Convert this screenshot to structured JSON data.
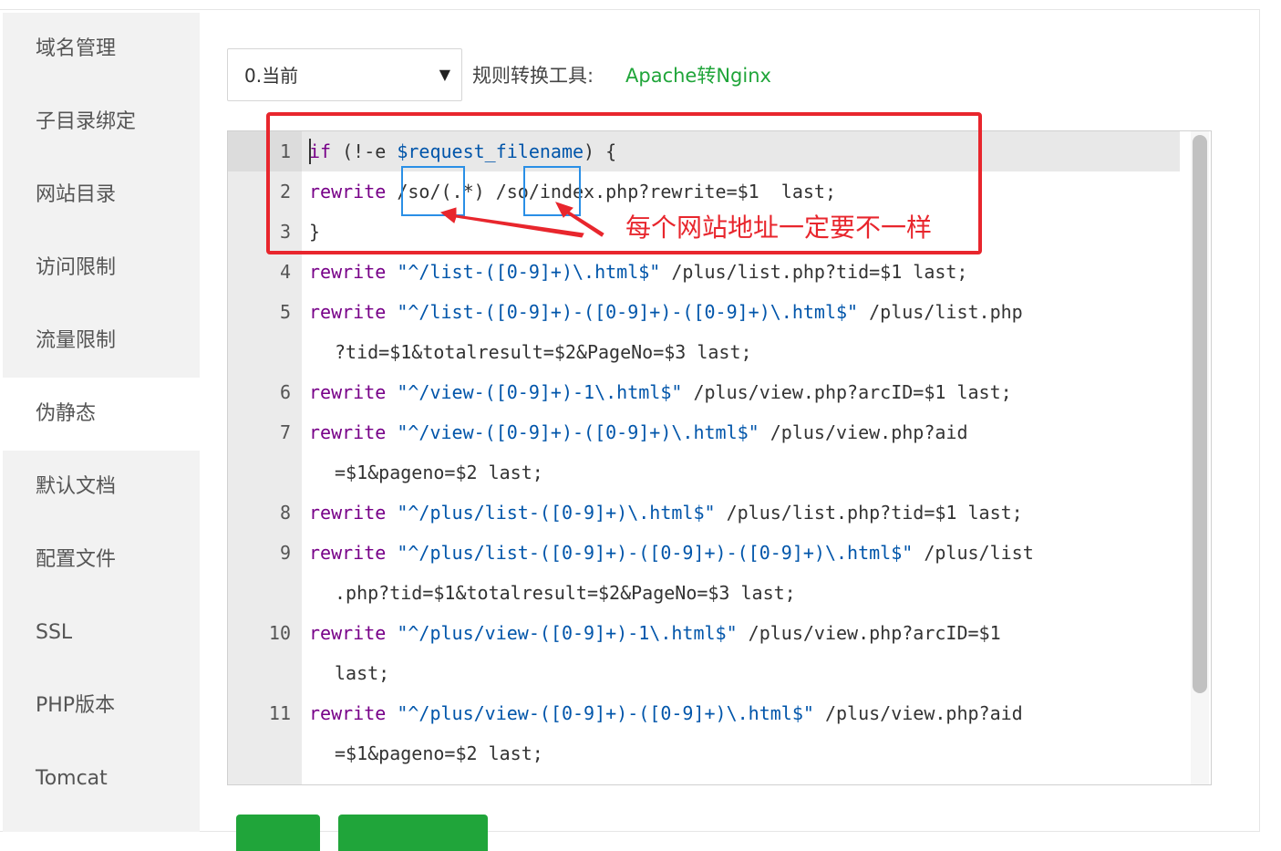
{
  "sidebar": {
    "items": [
      {
        "label": "域名管理"
      },
      {
        "label": "子目录绑定"
      },
      {
        "label": "网站目录"
      },
      {
        "label": "访问限制"
      },
      {
        "label": "流量限制"
      },
      {
        "label": "伪静态",
        "active": true
      },
      {
        "label": "默认文档"
      },
      {
        "label": "配置文件"
      },
      {
        "label": "SSL"
      },
      {
        "label": "PHP版本"
      },
      {
        "label": "Tomcat"
      }
    ]
  },
  "toolbar": {
    "select_value": "0.当前",
    "caret": "▼",
    "tool_label": "规则转换工具:",
    "tool_link": "Apache转Nginx"
  },
  "editor": {
    "lines": [
      {
        "num": "1"
      },
      {
        "num": "2"
      },
      {
        "num": "3"
      },
      {
        "num": "4"
      },
      {
        "num": "5"
      },
      {
        "num": "6"
      },
      {
        "num": "7"
      },
      {
        "num": "8"
      },
      {
        "num": "9"
      },
      {
        "num": "10"
      },
      {
        "num": "11"
      }
    ],
    "tokens": {
      "l1": [
        "if",
        " (!-e ",
        "$request_filename",
        ") {"
      ],
      "l2": [
        "rewrite",
        " /so/(.*) /so/index.php?rewrite=$1  last;"
      ],
      "l3": [
        "}"
      ],
      "l4": [
        "rewrite",
        " ",
        "\"^/list-([0-9]+)\\.html$\"",
        " /plus/list.php?tid=$1 last;"
      ],
      "l5a": [
        "rewrite",
        " ",
        "\"^/list-([0-9]+)-([0-9]+)-([0-9]+)\\.html$\"",
        " /plus/list.php"
      ],
      "l5b": "?tid=$1&totalresult=$2&PageNo=$3 last;",
      "l6": [
        "rewrite",
        " ",
        "\"^/view-([0-9]+)-1\\.html$\"",
        " /plus/view.php?arcID=$1 last;"
      ],
      "l7a": [
        "rewrite",
        " ",
        "\"^/view-([0-9]+)-([0-9]+)\\.html$\"",
        " /plus/view.php?aid"
      ],
      "l7b": "=$1&pageno=$2 last;",
      "l8": [
        "rewrite",
        " ",
        "\"^/plus/list-([0-9]+)\\.html$\"",
        " /plus/list.php?tid=$1 last;"
      ],
      "l9a": [
        "rewrite",
        " ",
        "\"^/plus/list-([0-9]+)-([0-9]+)-([0-9]+)\\.html$\"",
        " /plus/list"
      ],
      "l9b": ".php?tid=$1&totalresult=$2&PageNo=$3 last;",
      "l10a": [
        "rewrite",
        " ",
        "\"^/plus/view-([0-9]+)-1\\.html$\"",
        " /plus/view.php?arcID=$1"
      ],
      "l10b": "last;",
      "l11a": [
        "rewrite",
        " ",
        "\"^/plus/view-([0-9]+)-([0-9]+)\\.html$\"",
        " /plus/view.php?aid"
      ],
      "l11b": "=$1&pageno=$2 last;"
    }
  },
  "annotation": {
    "text": "每个网站地址一定要不一样",
    "color": "#e8262d"
  },
  "colors": {
    "accent": "#20a53a",
    "annotation_red": "#e8262d",
    "highlight_blue": "#2a8fe6"
  }
}
